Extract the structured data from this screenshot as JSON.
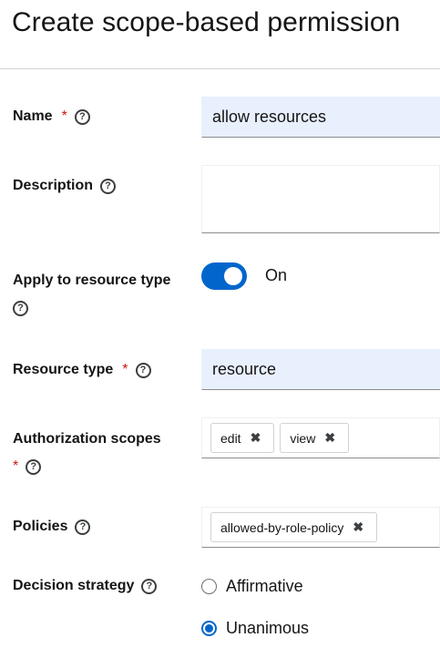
{
  "page": {
    "title": "Create scope-based permission"
  },
  "help_glyph": "?",
  "close_glyph": "✖",
  "fields": {
    "name": {
      "label": "Name",
      "required_mark": "*",
      "value": "allow resources"
    },
    "description": {
      "label": "Description",
      "value": ""
    },
    "apply_to_resource_type": {
      "label": "Apply to resource type",
      "state_label": "On",
      "enabled": true
    },
    "resource_type": {
      "label": "Resource type",
      "required_mark": "*",
      "value": "resource"
    },
    "authorization_scopes": {
      "label": "Authorization scopes",
      "required_mark": "*",
      "chips": [
        "edit",
        "view"
      ]
    },
    "policies": {
      "label": "Policies",
      "chips": [
        "allowed-by-role-policy"
      ]
    },
    "decision_strategy": {
      "label": "Decision strategy",
      "options": [
        {
          "label": "Affirmative",
          "selected": false
        },
        {
          "label": "Unanimous",
          "selected": true
        }
      ]
    }
  },
  "colors": {
    "accent": "#0066cc",
    "required": "#c9190b",
    "autofill": "#e8f0fe"
  }
}
